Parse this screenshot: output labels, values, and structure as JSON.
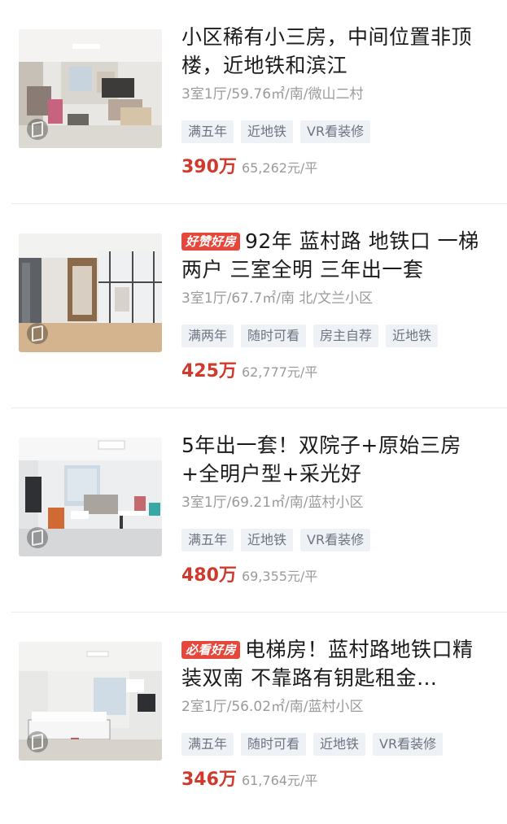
{
  "listings": [
    {
      "badge": "",
      "title": "小区稀有小三房，中间位置非顶楼，近地铁和滨江",
      "meta": "3室1厅/59.76㎡/南/微山二村",
      "tags": [
        "满五年",
        "近地铁",
        "VR看装修"
      ],
      "price": "390万",
      "unit_price": "65,262元/平"
    },
    {
      "badge": "好赞好房",
      "title": "92年 蓝村路 地铁口 一梯两户 三室全明 三年出一套",
      "meta": "3室1厅/67.7㎡/南 北/文兰小区",
      "tags": [
        "满两年",
        "随时可看",
        "房主自荐",
        "近地铁"
      ],
      "price": "425万",
      "unit_price": "62,777元/平"
    },
    {
      "badge": "",
      "title": "5年出一套！双院子+原始三房+全明户型+采光好",
      "meta": "3室1厅/69.21㎡/南/蓝村小区",
      "tags": [
        "满五年",
        "近地铁",
        "VR看装修"
      ],
      "price": "480万",
      "unit_price": "69,355元/平"
    },
    {
      "badge": "必看好房",
      "title": "电梯房！蓝村路地铁口精装双南 不靠路有钥匙租金…",
      "meta": "2室1厅/56.02㎡/南/蓝村小区",
      "tags": [
        "满五年",
        "随时可看",
        "近地铁",
        "VR看装修"
      ],
      "price": "346万",
      "unit_price": "61,764元/平"
    }
  ],
  "colors": {
    "price": "#d03a2c",
    "badge": "#e5483b",
    "tag_bg": "#eef1f5",
    "tag_text": "#6d7480",
    "meta_text": "#9a9a9a"
  },
  "icons": {
    "vr": "vr-panorama-icon"
  }
}
